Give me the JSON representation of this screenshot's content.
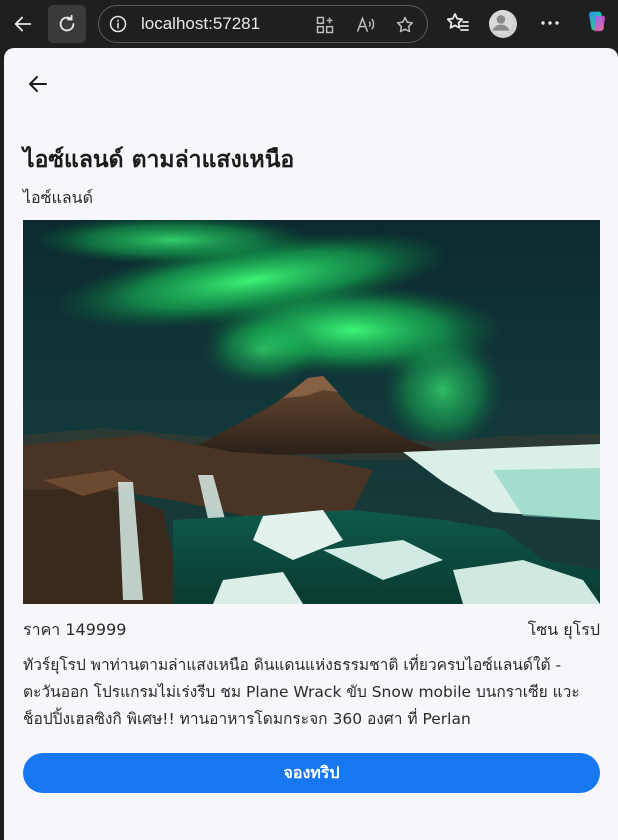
{
  "browser": {
    "url": "localhost:57281"
  },
  "page": {
    "title": "ไอซ์แลนด์ ตามล่าแสงเหนือ",
    "country": "ไอซ์แลนด์",
    "price": "ราคา 149999",
    "zone": "โซน ยุโรป",
    "description": "ทัวร์ยุโรป พาท่านตามล่าแสงเหนือ ดินแดนแห่งธรรมชาติ เที่ยวครบไอซ์แลนด์ใต้ - ตะวันออก โปรแกรมไม่เร่งรีบ ชม Plane Wrack ขับ Snow mobile บนกราเซีย แวะช็อปปิ้งเฮลซิงกิ พิเศษ!! ทานอาหารโดมกระจก 360 องศา ที่ Perlan",
    "book_button": "จองทริป"
  },
  "colors": {
    "accent": "#1677f0",
    "page_bg": "#f7f7fb",
    "chrome_bg": "#1f1f1f"
  }
}
